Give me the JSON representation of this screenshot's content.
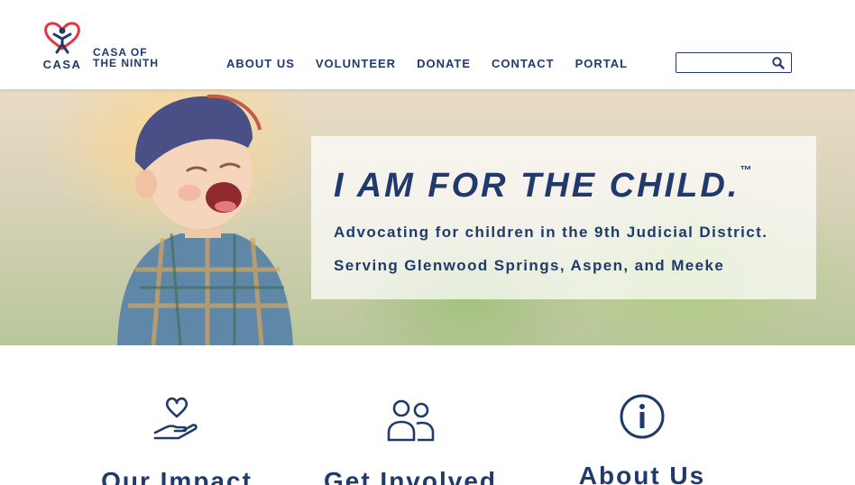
{
  "brand": {
    "logo_word": "CASA",
    "name_line1": "CASA OF",
    "name_line2": "THE NINTH",
    "colors": {
      "primary": "#1f3a6b",
      "heart": "#e2373f"
    }
  },
  "nav": {
    "items": [
      {
        "label": "ABOUT US"
      },
      {
        "label": "VOLUNTEER"
      },
      {
        "label": "DONATE"
      },
      {
        "label": "CONTACT"
      },
      {
        "label": "PORTAL"
      }
    ]
  },
  "search": {
    "value": "",
    "placeholder": "",
    "icon": "search-icon"
  },
  "hero": {
    "title": "I AM FOR THE CHILD.",
    "trademark": "™",
    "subtitle_line1": "Advocating for children in the 9th Judicial District.",
    "subtitle_line2": "Serving Glenwood Springs, Aspen, and Meeke"
  },
  "features": [
    {
      "title": "Our Impact",
      "icon": "heart-hand-icon"
    },
    {
      "title": "Get Involved",
      "icon": "people-icon"
    },
    {
      "title": "About Us",
      "icon": "info-icon"
    }
  ]
}
